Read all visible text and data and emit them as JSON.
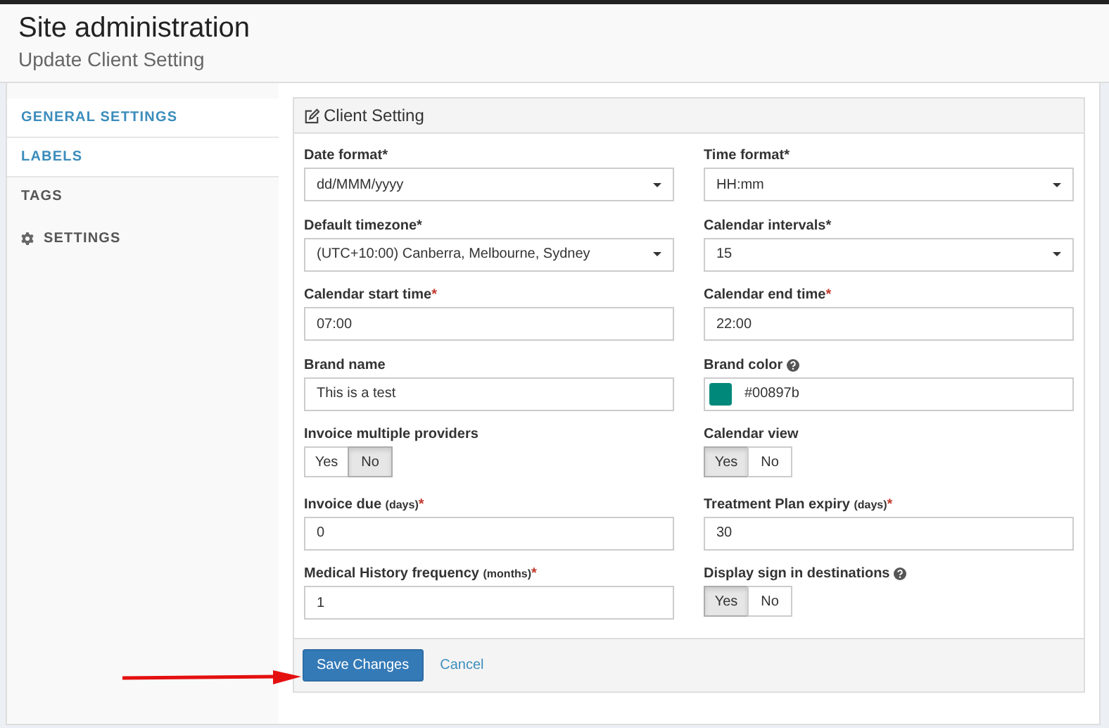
{
  "header": {
    "title": "Site administration",
    "subtitle": "Update Client Setting"
  },
  "sidebar": {
    "items": [
      {
        "label": "GENERAL SETTINGS",
        "kind": "link",
        "highlighted": true
      },
      {
        "label": "LABELS",
        "kind": "link",
        "highlighted": true
      },
      {
        "label": "TAGS",
        "kind": "link",
        "highlighted": false
      },
      {
        "label": "SETTINGS",
        "kind": "section",
        "highlighted": false
      }
    ]
  },
  "panel": {
    "title": "Client Setting",
    "fields": [
      {
        "kind": "select",
        "label": "Date format",
        "mark": "*",
        "mark_red": false,
        "value": "dd/MMM/yyyy"
      },
      {
        "kind": "select",
        "label": "Time format",
        "mark": "*",
        "mark_red": false,
        "value": "HH:mm"
      },
      {
        "kind": "select",
        "label": "Default timezone",
        "mark": "*",
        "mark_red": false,
        "value": "(UTC+10:00) Canberra, Melbourne, Sydney"
      },
      {
        "kind": "select",
        "label": "Calendar intervals",
        "mark": "*",
        "mark_red": false,
        "value": "15"
      },
      {
        "kind": "text",
        "label": "Calendar start time",
        "mark": "*",
        "mark_red": true,
        "value": "07:00"
      },
      {
        "kind": "text",
        "label": "Calendar end time",
        "mark": "*",
        "mark_red": true,
        "value": "22:00"
      },
      {
        "kind": "text",
        "label": "Brand name",
        "value": "This is a test"
      },
      {
        "kind": "color",
        "label": "Brand color",
        "help": true,
        "value": "#00897b",
        "color": "#00897b"
      },
      {
        "kind": "toggle",
        "label": "Invoice multiple providers",
        "options": [
          {
            "label": "Yes",
            "selected": false
          },
          {
            "label": "No",
            "selected": true
          }
        ]
      },
      {
        "kind": "toggle",
        "label": "Calendar view",
        "options": [
          {
            "label": "Yes",
            "selected": true
          },
          {
            "label": "No",
            "selected": false
          }
        ]
      },
      {
        "kind": "text",
        "label": "Invoice due",
        "unit": "(days)",
        "mark": "*",
        "mark_red": true,
        "value": "0"
      },
      {
        "kind": "text",
        "label": "Treatment Plan expiry",
        "unit": "(days)",
        "mark": "*",
        "mark_red": true,
        "value": "30"
      },
      {
        "kind": "text",
        "label": "Medical History frequency",
        "unit": "(months)",
        "mark": "*",
        "mark_red": true,
        "value": "1"
      },
      {
        "kind": "toggle",
        "label": "Display sign in destinations",
        "help": true,
        "options": [
          {
            "label": "Yes",
            "selected": true
          },
          {
            "label": "No",
            "selected": false
          }
        ]
      }
    ],
    "save_button": "Save Changes",
    "cancel_link": "Cancel"
  },
  "annotation": {
    "kind": "arrow"
  }
}
